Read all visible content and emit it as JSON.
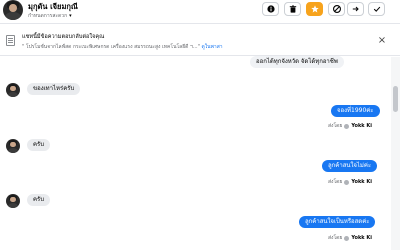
{
  "header": {
    "contact_name": "มุกุดัน เจียมกุณี",
    "status_text": "กำหนดการสะดวก",
    "icons": [
      "info-icon",
      "trash-icon",
      "star-icon",
      "block-icon",
      "forward-icon",
      "check-icon"
    ],
    "accent_color": "#f7a31c"
  },
  "banner": {
    "title": "แชทนี้มีข้อความตอบกลับต่อใจคุณ",
    "subtitle": "\" โปรโมชั่นจากไลฟ์สด กระเบะพิเศษกรด เครื่องแรง สมรรถนะสูง เทคโนโลยีดี ฯ...\"",
    "link_text": "ดูในพาสา",
    "close_glyph": "×"
  },
  "messages": [
    {
      "direction": "in",
      "text": "ออกได้ทุกจังหวัด จัดได้ทุกอาชีพ"
    },
    {
      "direction": "in",
      "text": "ของเทาไหร่ครับ"
    },
    {
      "direction": "out",
      "text": "จองที่1990ค่ะ",
      "meta_prefix": "ส่งโดย",
      "sender": "Yokk Ki"
    },
    {
      "direction": "in",
      "text": "ครับ"
    },
    {
      "direction": "out",
      "text": "ลูกค้าสนใจไม่ค่ะ",
      "meta_prefix": "ส่งโดย",
      "sender": "Yokk Ki"
    },
    {
      "direction": "in",
      "text": "ครับ"
    },
    {
      "direction": "out",
      "text": "ลูกค้าสนใจเป็นหรือสดค่ะ",
      "meta_prefix": "ส่งโดย",
      "sender": "Yokk Ki"
    }
  ],
  "colors": {
    "outgoing_bubble": "#1877f2",
    "incoming_bubble": "#e9ebee"
  }
}
